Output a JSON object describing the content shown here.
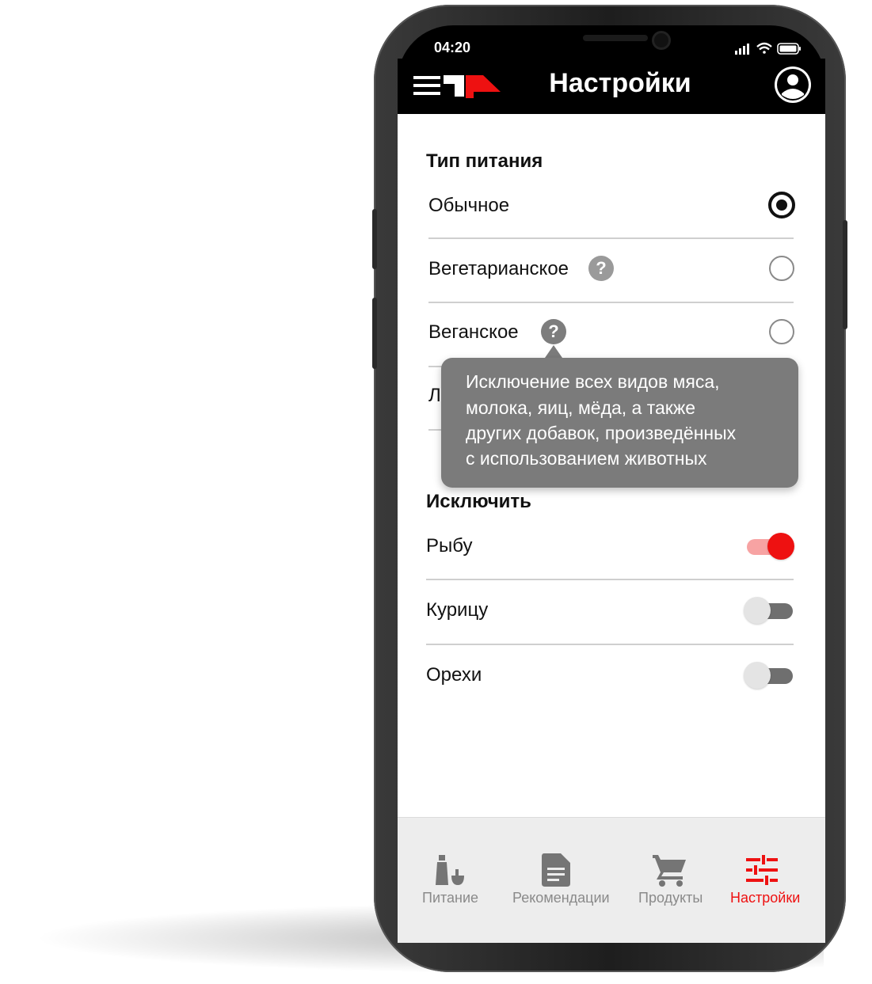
{
  "status_bar": {
    "time": "04:20"
  },
  "app_bar": {
    "title": "Настройки"
  },
  "diet_section": {
    "heading": "Тип питания",
    "options": [
      {
        "label": "Обычное",
        "selected": true,
        "has_help": false
      },
      {
        "label": "Вегетарианское",
        "selected": false,
        "has_help": true
      },
      {
        "label": "Веганское",
        "selected": false,
        "has_help": true
      },
      {
        "label": "Л",
        "selected": false,
        "has_help": false
      }
    ]
  },
  "tooltip": {
    "lines": [
      "Исключение всех видов мяса,",
      "молока, яиц, мёда, а также",
      "других добавок, произведённых",
      "с использованием животных"
    ]
  },
  "exclude_section": {
    "heading": "Исключить",
    "items": [
      {
        "label": "Рыбу",
        "enabled": true
      },
      {
        "label": "Курицу",
        "enabled": false
      },
      {
        "label": "Орехи",
        "enabled": false
      }
    ]
  },
  "bottom_nav": [
    {
      "label": "Питание",
      "icon": "bottles-icon",
      "active": false
    },
    {
      "label": "Рекомендации",
      "icon": "document-icon",
      "active": false
    },
    {
      "label": "Продукты",
      "icon": "cart-icon",
      "active": false
    },
    {
      "label": "Настройки",
      "icon": "sliders-icon",
      "active": true
    }
  ],
  "colors": {
    "accent": "#ee1111",
    "appbar": "#000000",
    "tooltip": "#7b7b7b",
    "nav_background": "#ededed"
  }
}
